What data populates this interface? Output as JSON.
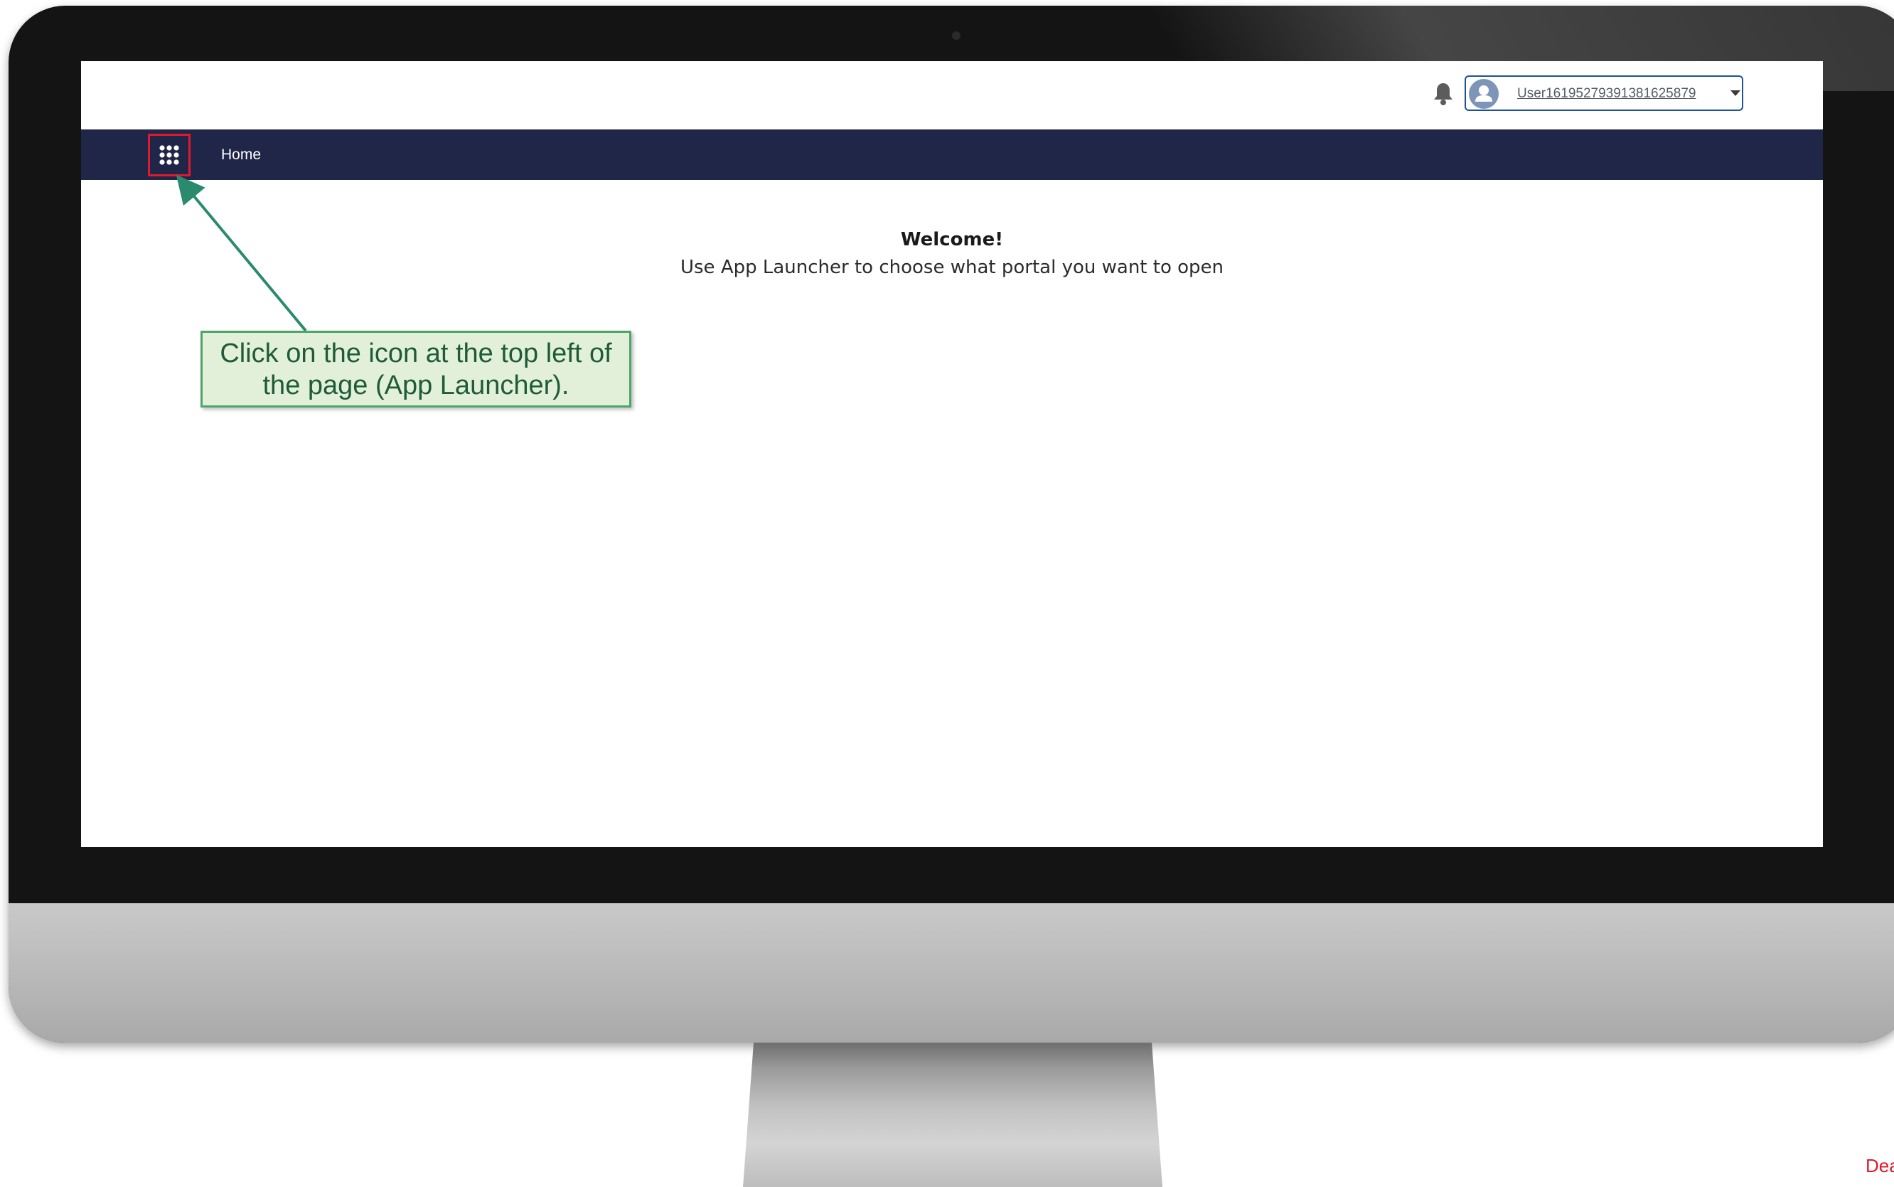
{
  "header": {
    "notifications_icon": "bell-icon",
    "user": {
      "avatar_icon": "user-avatar-icon",
      "name": "User16195279391381625879",
      "dropdown_icon": "chevron-down-icon"
    }
  },
  "nav": {
    "app_launcher_icon": "app-launcher-grid-icon",
    "home_label": "Home",
    "background_color": "#1f2647",
    "highlight_color": "#e01a2c"
  },
  "main": {
    "title": "Welcome!",
    "subtitle": "Use App Launcher to choose what portal you want to open"
  },
  "annotation": {
    "text": "Click on the icon at the top left of the page (App Launcher).",
    "border_color": "#4ea568",
    "fill_color": "#e2f0d9"
  },
  "corner_text": "Dea"
}
